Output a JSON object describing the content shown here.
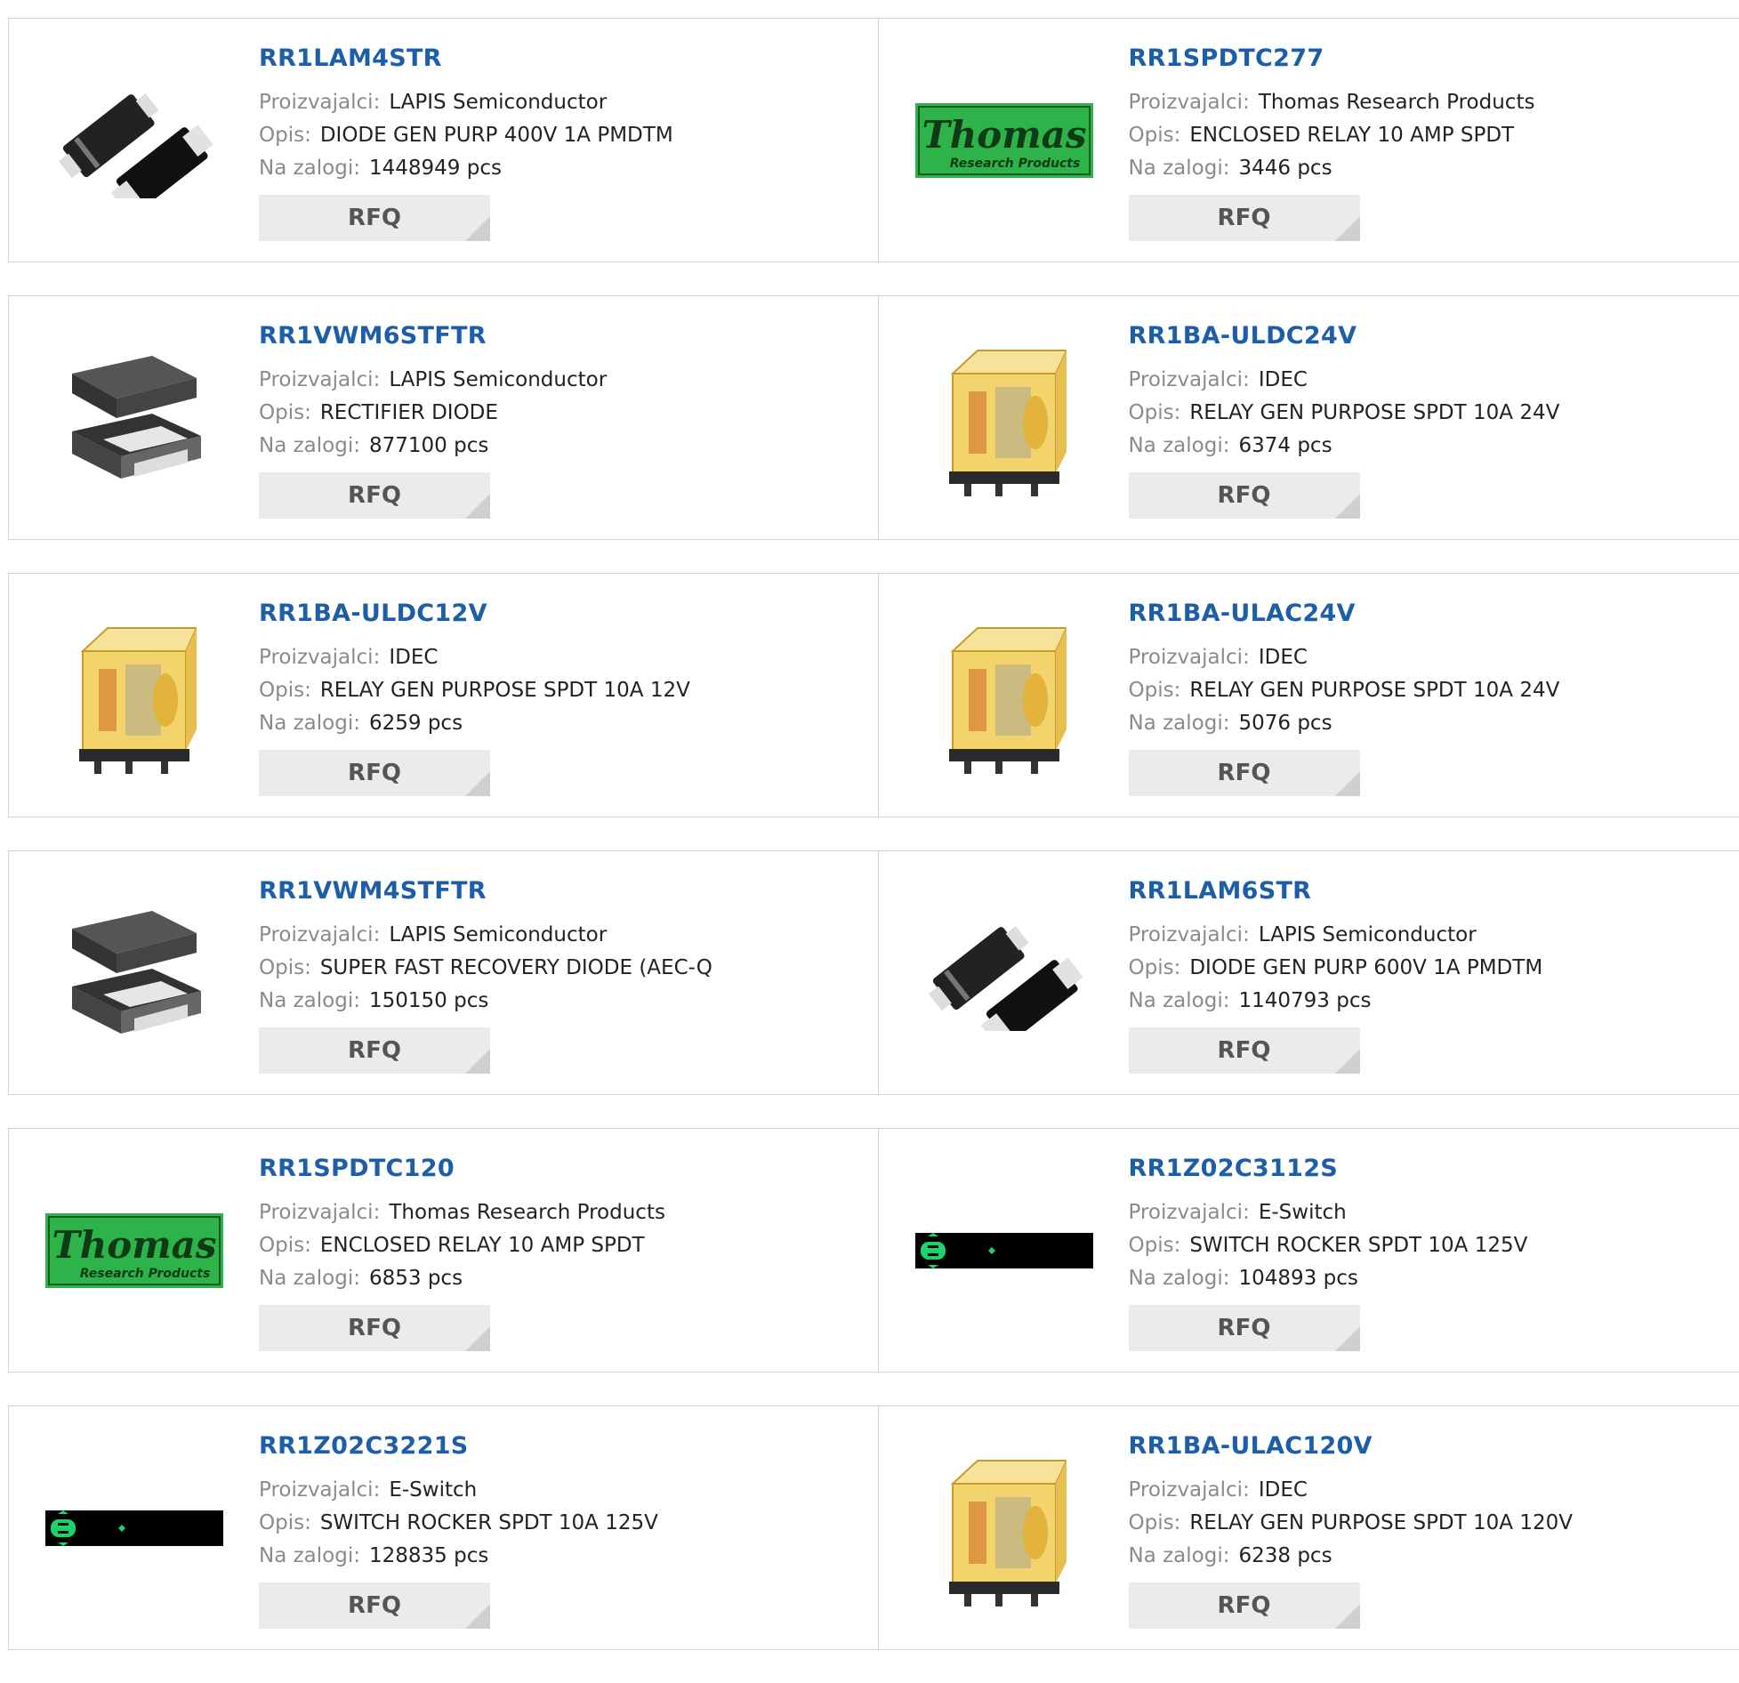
{
  "labels": {
    "manufacturer": "Proizvajalci:",
    "description": "Opis:",
    "stock": "Na zalogi:",
    "rfq": "RFQ"
  },
  "colors": {
    "part_link": "#1d5ea8",
    "rfq_bg": "#ebebeb",
    "border": "#d3d3d3"
  },
  "products": [
    {
      "part": "RR1LAM4STR",
      "manufacturer": "LAPIS Semiconductor",
      "description": "DIODE GEN PURP 400V 1A PMDTM",
      "stock": "1448949 pcs",
      "image": "smd-diode-pair-icon"
    },
    {
      "part": "RR1SPDTC277",
      "manufacturer": "Thomas Research Products",
      "description": "ENCLOSED RELAY 10 AMP SPDT",
      "stock": "3446 pcs",
      "image": "thomas-logo",
      "logo_text": "Thomas",
      "logo_sub": "Research Products"
    },
    {
      "part": "RR1VWM6STFTR",
      "manufacturer": "LAPIS Semiconductor",
      "description": "RECTIFIER DIODE",
      "stock": "877100 pcs",
      "image": "smd-package-icon"
    },
    {
      "part": "RR1BA-ULDC24V",
      "manufacturer": "IDEC",
      "description": "RELAY GEN PURPOSE SPDT 10A 24V",
      "stock": "6374 pcs",
      "image": "relay-icon"
    },
    {
      "part": "RR1BA-ULDC12V",
      "manufacturer": "IDEC",
      "description": "RELAY GEN PURPOSE SPDT 10A 12V",
      "stock": "6259 pcs",
      "image": "relay-icon"
    },
    {
      "part": "RR1BA-ULAC24V",
      "manufacturer": "IDEC",
      "description": "RELAY GEN PURPOSE SPDT 10A 24V",
      "stock": "5076 pcs",
      "image": "relay-icon"
    },
    {
      "part": "RR1VWM4STFTR",
      "manufacturer": "LAPIS Semiconductor",
      "description": "SUPER FAST RECOVERY DIODE (AEC-Q",
      "stock": "150150 pcs",
      "image": "smd-package-icon"
    },
    {
      "part": "RR1LAM6STR",
      "manufacturer": "LAPIS Semiconductor",
      "description": "DIODE GEN PURP 600V 1A PMDTM",
      "stock": "1140793 pcs",
      "image": "smd-diode-pair-icon"
    },
    {
      "part": "RR1SPDTC120",
      "manufacturer": "Thomas Research Products",
      "description": "ENCLOSED RELAY 10 AMP SPDT",
      "stock": "6853 pcs",
      "image": "thomas-logo",
      "logo_text": "Thomas",
      "logo_sub": "Research Products"
    },
    {
      "part": "RR1Z02C3112S",
      "manufacturer": "E-Switch",
      "description": "SWITCH ROCKER SPDT 10A 125V",
      "stock": "104893 pcs",
      "image": "rocker-switch-icon"
    },
    {
      "part": "RR1Z02C3221S",
      "manufacturer": "E-Switch",
      "description": "SWITCH ROCKER SPDT 10A 125V",
      "stock": "128835 pcs",
      "image": "rocker-switch-icon"
    },
    {
      "part": "RR1BA-ULAC120V",
      "manufacturer": "IDEC",
      "description": "RELAY GEN PURPOSE SPDT 10A 120V",
      "stock": "6238 pcs",
      "image": "relay-icon"
    }
  ]
}
